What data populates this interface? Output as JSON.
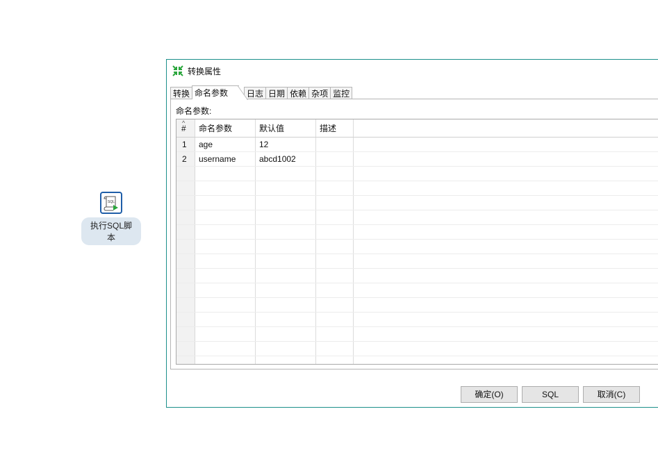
{
  "canvas": {
    "step_label": "执行SQL脚本",
    "step_icon": "sql-script-icon"
  },
  "dialog": {
    "title": "转换属性",
    "title_icon": "kettle-transform-icon",
    "tabs": [
      {
        "label": "转换"
      },
      {
        "label": "命名参数"
      },
      {
        "label": "日志"
      },
      {
        "label": "日期"
      },
      {
        "label": "依赖"
      },
      {
        "label": "杂项"
      },
      {
        "label": "监控"
      }
    ],
    "active_tab": "命名参数",
    "section_label": "命名参数:",
    "table": {
      "columns": [
        "#",
        "命名参数",
        "默认值",
        "描述"
      ],
      "rows": [
        {
          "num": "1",
          "name": "age",
          "default": "12",
          "desc": ""
        },
        {
          "num": "2",
          "name": "username",
          "default": "abcd1002",
          "desc": ""
        }
      ]
    },
    "buttons": {
      "ok": "确定(O)",
      "sql": "SQL",
      "cancel": "取消(C)"
    }
  },
  "colors": {
    "dialog_border": "#1b8f8a",
    "title_icon_green": "#2aa63c",
    "step_icon_border": "#1f5ea8"
  }
}
